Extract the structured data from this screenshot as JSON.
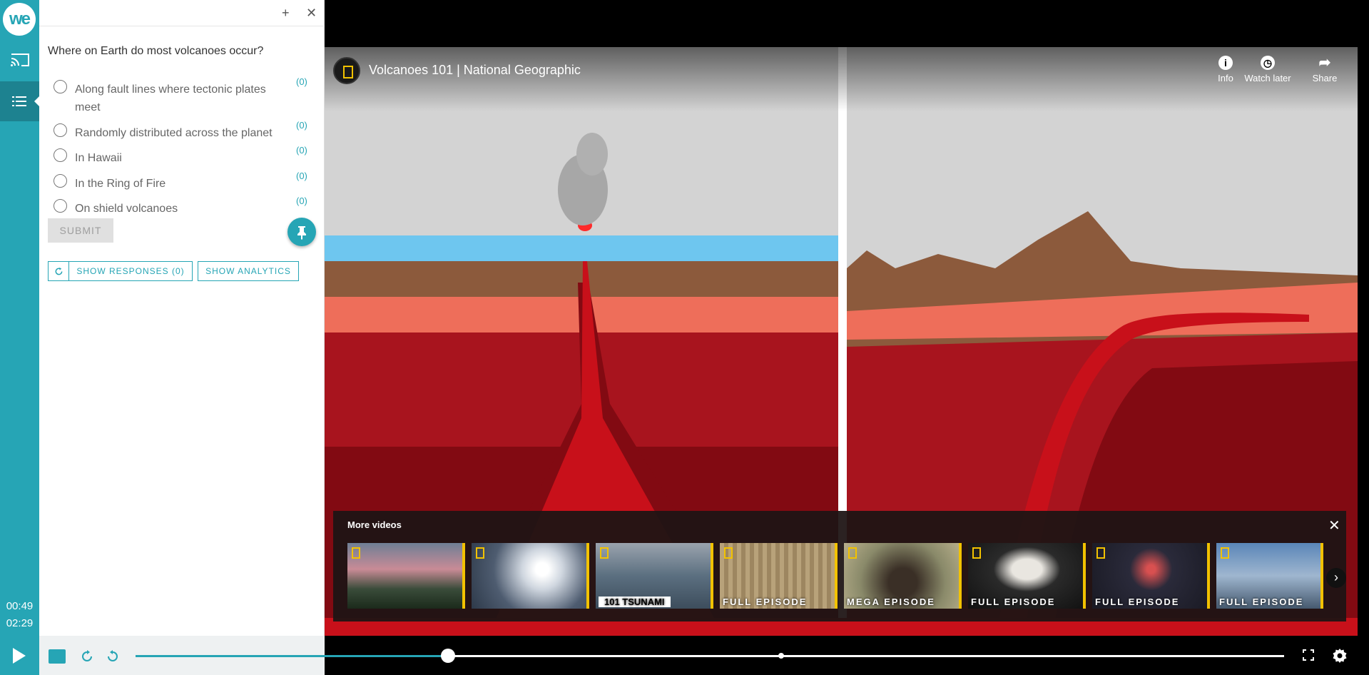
{
  "app": {
    "logo_text": "we"
  },
  "player": {
    "current_time": "00:49",
    "duration": "02:29",
    "progress": 0.272,
    "marker_position": 0.562
  },
  "quiz": {
    "question": "Where on Earth do most volcanoes occur?",
    "options": [
      {
        "label": "Along fault lines where tectonic plates meet",
        "count": "(0)"
      },
      {
        "label": "Randomly distributed across the planet",
        "count": "(0)"
      },
      {
        "label": "In Hawaii",
        "count": "(0)"
      },
      {
        "label": "In the Ring of Fire",
        "count": "(0)"
      },
      {
        "label": "On shield volcanoes",
        "count": "(0)"
      }
    ],
    "submit_label": "SUBMIT",
    "show_responses_label": "SHOW RESPONSES (0)",
    "show_analytics_label": "SHOW ANALYTICS"
  },
  "video": {
    "title": "Volcanoes 101 | National Geographic",
    "controls": {
      "info": "Info",
      "watch_later": "Watch later",
      "share": "Share"
    },
    "more_videos": {
      "title": "More videos",
      "thumbs": [
        {
          "caption": ""
        },
        {
          "caption": ""
        },
        {
          "caption": "101 TSUNAMI"
        },
        {
          "caption": "FULL EPISODE"
        },
        {
          "caption": "MEGA EPISODE"
        },
        {
          "caption": "FULL EPISODE"
        },
        {
          "caption": "FULL EPISODE"
        },
        {
          "caption": "FULL EPISODE"
        }
      ]
    }
  },
  "colors": {
    "accent": "#26a5b5",
    "accent_dark": "#1d8290",
    "brand_yellow": "#f2c200"
  }
}
